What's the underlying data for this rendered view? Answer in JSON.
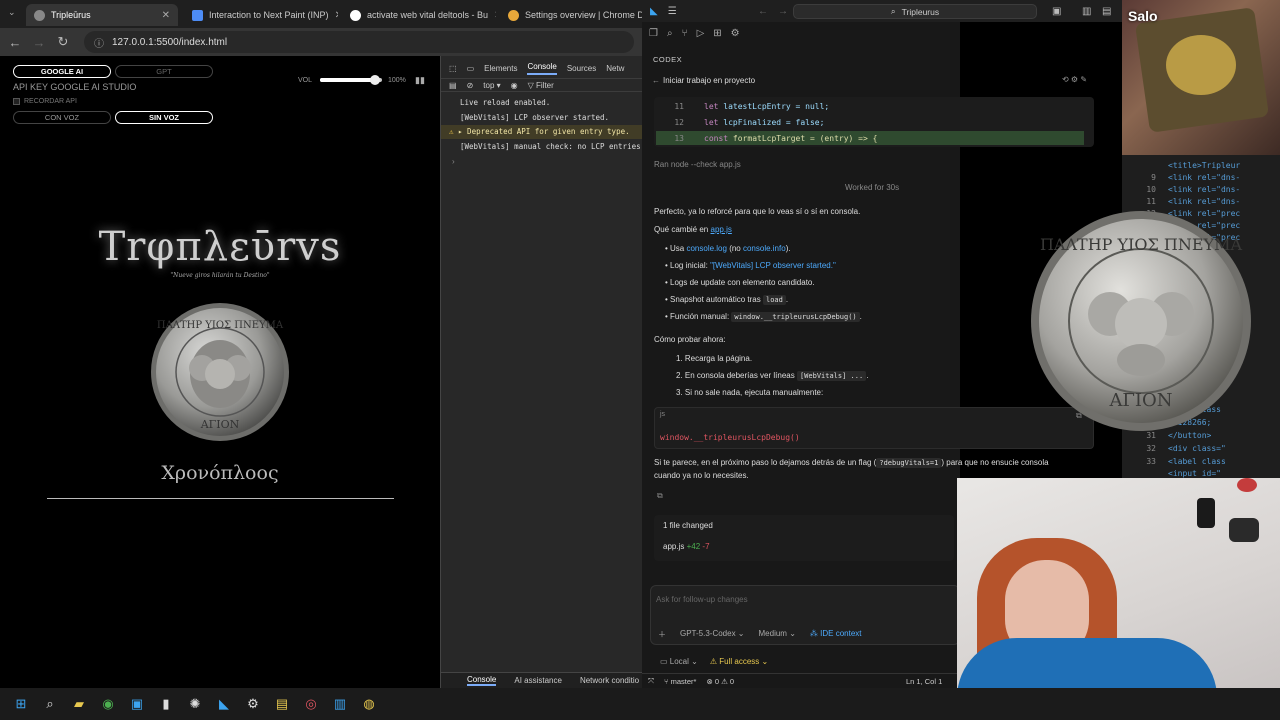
{
  "browser": {
    "tabs": [
      {
        "title": "Tripleūrus",
        "active": true
      },
      {
        "title": "Interaction to Next Paint (INP)",
        "active": false
      },
      {
        "title": "activate web vital deltools - Bu",
        "active": false
      },
      {
        "title": "Settings overview | Chrome D",
        "active": false
      }
    ],
    "url": "127.0.0.1:5500/index.html"
  },
  "page": {
    "btn_google": "GOOGLE AI",
    "btn_gpt": "GPT",
    "vol_label": "VOL",
    "vol_pct": "100%",
    "volume_level": 0.85,
    "api_key": "API KEY GOOGLE AI STUDIO",
    "remember": "RECORDAR API",
    "btn_con_voz": "CON VOZ",
    "btn_sin_voz": "SIN VOZ",
    "brand": "Trφπλεῡrvs",
    "motto": "\"Nueve giros hilarán tu Destino\"",
    "coin_top_text": "ΠΑΛΤΗΡ ΥΙΟΣ ΠΝΕΥΜΑ",
    "coin_bottom_text": "ΑΓΙΟΝ",
    "chronos": "Χρονόπλοος"
  },
  "devtools": {
    "tabs": [
      "Elements",
      "Console",
      "Sources",
      "Netw"
    ],
    "context": "top",
    "filter": "Filter",
    "logs": [
      {
        "text": "Live reload enabled.",
        "level": "info"
      },
      {
        "text": "[WebVitals] LCP observer started.",
        "level": "info"
      },
      {
        "text": "▸ Deprecated API for given entry type.",
        "level": "warn"
      },
      {
        "text": "[WebVitals] manual check: no LCP entries",
        "level": "info"
      }
    ],
    "drawer": [
      "Console",
      "AI assistance",
      "Network conditio"
    ]
  },
  "vscode": {
    "search": "Tripleurus",
    "panel": "CODEX",
    "task": "Iniciar trabajo en proyecto",
    "code": [
      {
        "ln": "11",
        "kw": "let",
        "rest": "latestLcpEntry = null;"
      },
      {
        "ln": "12",
        "kw": "let",
        "rest": "lcpFinalized = false;"
      },
      {
        "ln": "13",
        "kw": "const",
        "rest": "formatLcpTarget = (entry) => {"
      }
    ],
    "ran": "Ran node --check app.js",
    "worked": "Worked for 30s",
    "intro": "Perfecto, ya lo reforcé para que lo veas sí o sí en consola.",
    "changed_prefix": "Qué cambié en",
    "changed_file": "app.js",
    "bullets": [
      {
        "pre": "Usa ",
        "link1": "console.log",
        "mid": " (no ",
        "link2": "console.info",
        "post": ")."
      },
      {
        "pre": "Log inicial: ",
        "link1": "\"[WebVitals] LCP observer started.\""
      },
      {
        "pre": "Logs de update con elemento candidato."
      },
      {
        "pre": "Snapshot automático tras ",
        "code": "load",
        "post": "."
      },
      {
        "pre": "Función manual: ",
        "code": "window.__tripleurusLcpDebug()",
        "post": "."
      }
    ],
    "how": "Cómo probar ahora:",
    "steps": [
      {
        "pre": "1. Recarga la página."
      },
      {
        "pre": "2. En consola deberías ver líneas ",
        "code": "[WebVitals] ...",
        "post": "."
      },
      {
        "pre": "3. Si no sale nada, ejecuta manualmente:"
      }
    ],
    "js_lang": "js",
    "js_code": "window.__tripleurusLcpDebug()",
    "next1_pre": "Si te parece, en el próximo paso lo dejamos detrás de un flag (",
    "next1_code": "?debugVitals=1",
    "next1_post": ") para que no ensucie consola",
    "next2": "cuando ya no lo necesites.",
    "files_changed": "1 file changed",
    "file": "app.js",
    "added": "+42",
    "removed": "-7",
    "ask_placeholder": "Ask for follow-up changes",
    "model": "GPT-5.3-Codex",
    "effort": "Medium",
    "ide_context": "IDE context",
    "local": "Local",
    "access": "Full access",
    "branch": "master*",
    "errors": "0",
    "warnings": "0",
    "cursor": "Ln 1, Col 1"
  },
  "right_editor": {
    "lines": [
      {
        "ln": "",
        "text": "<title>Tripleur"
      },
      {
        "ln": "9",
        "text": "<link rel=\"dns-"
      },
      {
        "ln": "10",
        "text": "<link rel=\"dns-"
      },
      {
        "ln": "11",
        "text": "<link rel=\"dns-"
      },
      {
        "ln": "12",
        "text": "<link rel=\"prec"
      },
      {
        "ln": "13",
        "text": "<link rel=\"prec"
      },
      {
        "ln": "14",
        "text": "<link rel=\"prec"
      },
      {
        "ln": "28",
        "text": "class=\"sc"
      },
      {
        "ln": "29",
        "text": "utton class"
      },
      {
        "ln": "30",
        "text": "&#128266;"
      },
      {
        "ln": "31",
        "text": "</button>"
      },
      {
        "ln": "32",
        "text": "<div class=\""
      },
      {
        "ln": "33",
        "text": "<label class"
      },
      {
        "ln": "",
        "text": "<input id=\""
      }
    ]
  },
  "webcam_label": "Salo",
  "colors": {
    "accent": "#4daafc",
    "warn_bg": "#413c26",
    "highlight": "#2f4a2f"
  }
}
